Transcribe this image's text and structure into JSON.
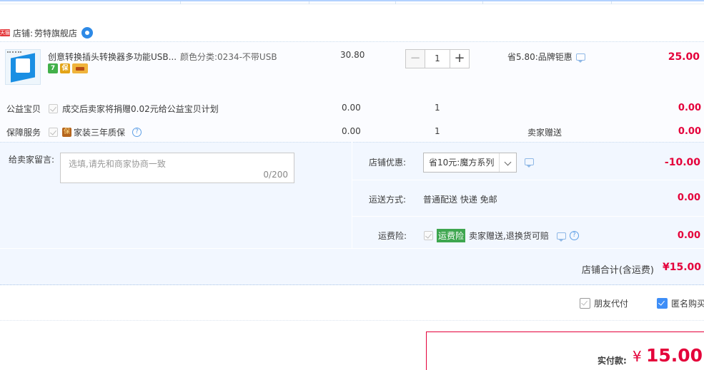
{
  "shop": {
    "badge": "天猫",
    "label": "店铺:",
    "name": "劳特旗舰店"
  },
  "item": {
    "title": "创意转换插头转换器多功能USB...",
    "sku": "颜色分类:0234-不带USB",
    "unit_price": "30.80",
    "quantity": "1",
    "minus": "−",
    "plus": "+",
    "promo": "省5.80:品牌钜惠",
    "subtotal": "25.00",
    "tags": [
      "7",
      "保"
    ]
  },
  "charity": {
    "label": "公益宝贝",
    "desc": "成交后卖家将捐赠0.02元给公益宝贝计划",
    "price": "0.00",
    "qty": "1",
    "total": "0.00"
  },
  "warranty": {
    "label": "保障服务",
    "badge": "保",
    "desc": "家装三年质保",
    "help": "?",
    "price": "0.00",
    "qty": "1",
    "note": "卖家赠送",
    "total": "0.00"
  },
  "message": {
    "label": "给卖家留言:",
    "placeholder": "选填,请先和商家协商一致",
    "count": "0/200"
  },
  "discount": {
    "label": "店铺优惠:",
    "selected": "省10元:魔方系列",
    "amount": "-10.00"
  },
  "shipping": {
    "label": "运送方式:",
    "method": "普通配送 快递 免邮",
    "amount": "0.00"
  },
  "insurance": {
    "label": "运费险:",
    "tag": "运费险",
    "desc": "卖家赠送,退换货可赔",
    "help": "?",
    "amount": "0.00"
  },
  "total": {
    "label": "店铺合计(含运费)",
    "value": "¥15.00"
  },
  "options": {
    "friend_pay": "朋友代付",
    "anonymous": "匿名购买"
  },
  "payment": {
    "label": "实付款:",
    "currency": "¥",
    "amount": "15.00"
  },
  "colors": {
    "accent_red": "#e4003a",
    "accent_blue": "#3e8ef7",
    "section_bg": "#f2f7ff"
  }
}
